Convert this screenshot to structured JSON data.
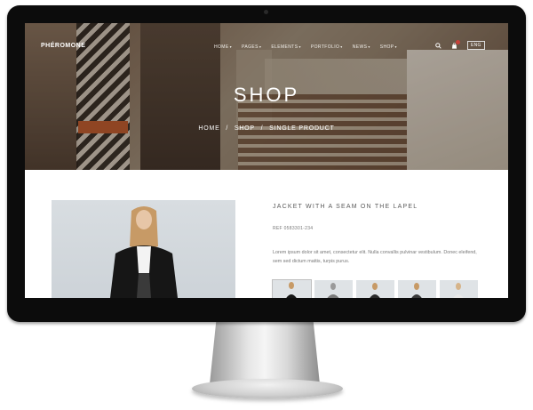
{
  "brand": {
    "logo": "PHÉROMONE"
  },
  "nav": {
    "items": [
      {
        "label": "HOME"
      },
      {
        "label": "PAGES"
      },
      {
        "label": "ELEMENTS"
      },
      {
        "label": "PORTFOLIO"
      },
      {
        "label": "NEWS"
      },
      {
        "label": "SHOP"
      }
    ],
    "lang": "ENG"
  },
  "hero": {
    "title": "SHOP",
    "breadcrumb": [
      "HOME",
      "SHOP",
      "SINGLE PRODUCT"
    ],
    "separator": "/"
  },
  "product": {
    "title": "JACKET WITH A SEAM ON THE LAPEL",
    "ref": "REF 0583301-234",
    "description": "Lorem ipsum dolor sit amet, consectetur elit. Nulla convallis pulvinar vestibulum. Donec eleifend, sem sed dictum mattis, turpis purus."
  },
  "colors": {
    "accent": "#c8413a"
  },
  "icons": [
    "search-icon",
    "shopping-bag-icon",
    "chevron-down-icon"
  ]
}
